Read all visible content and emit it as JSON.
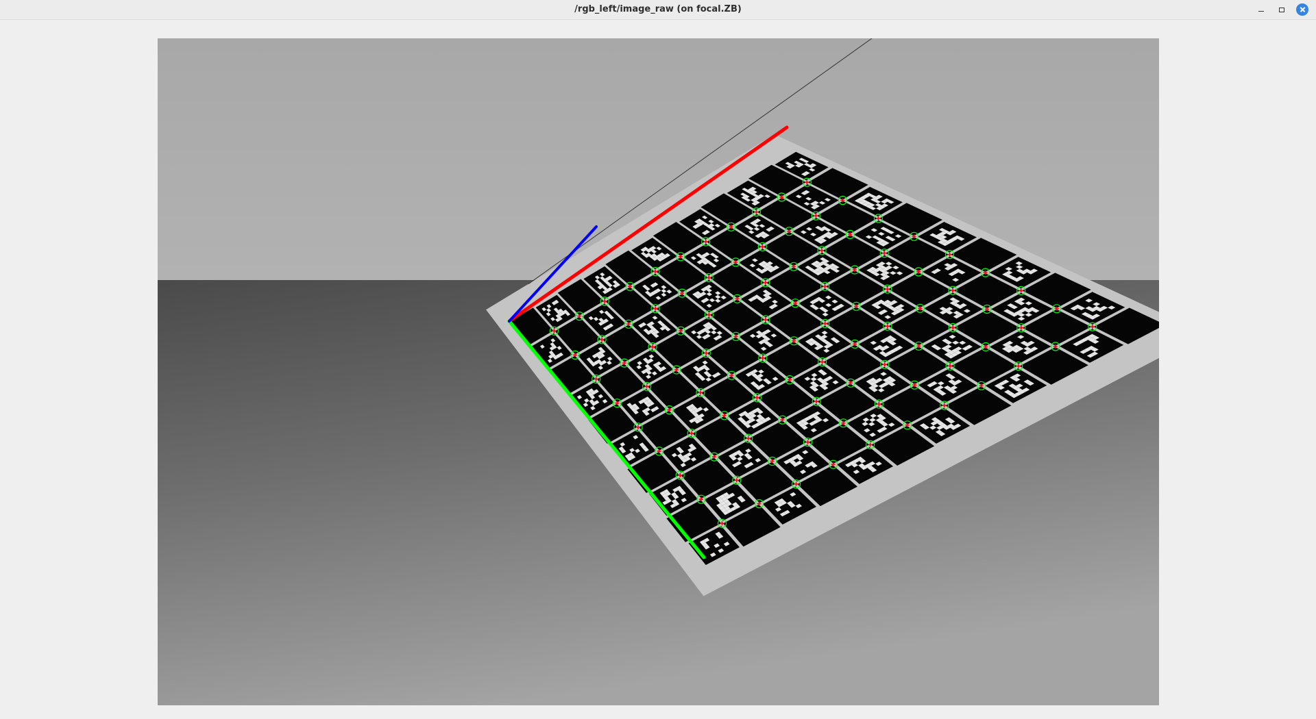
{
  "window": {
    "title": "/rgb_left/image_raw (on focal.ZB)",
    "controls": [
      "minimize-icon",
      "maximize-icon",
      "close-icon"
    ],
    "accent_color": "#3584e4"
  },
  "image": {
    "axis_colors": {
      "x_axis": "#ff0000",
      "y_axis": "#00ff00",
      "z_axis": "#0000ff"
    },
    "marker_colors": {
      "corner_circle": "#00ff00",
      "corner_cross": "#ff0000"
    },
    "board": {
      "rows": 10,
      "cols": 12
    }
  }
}
